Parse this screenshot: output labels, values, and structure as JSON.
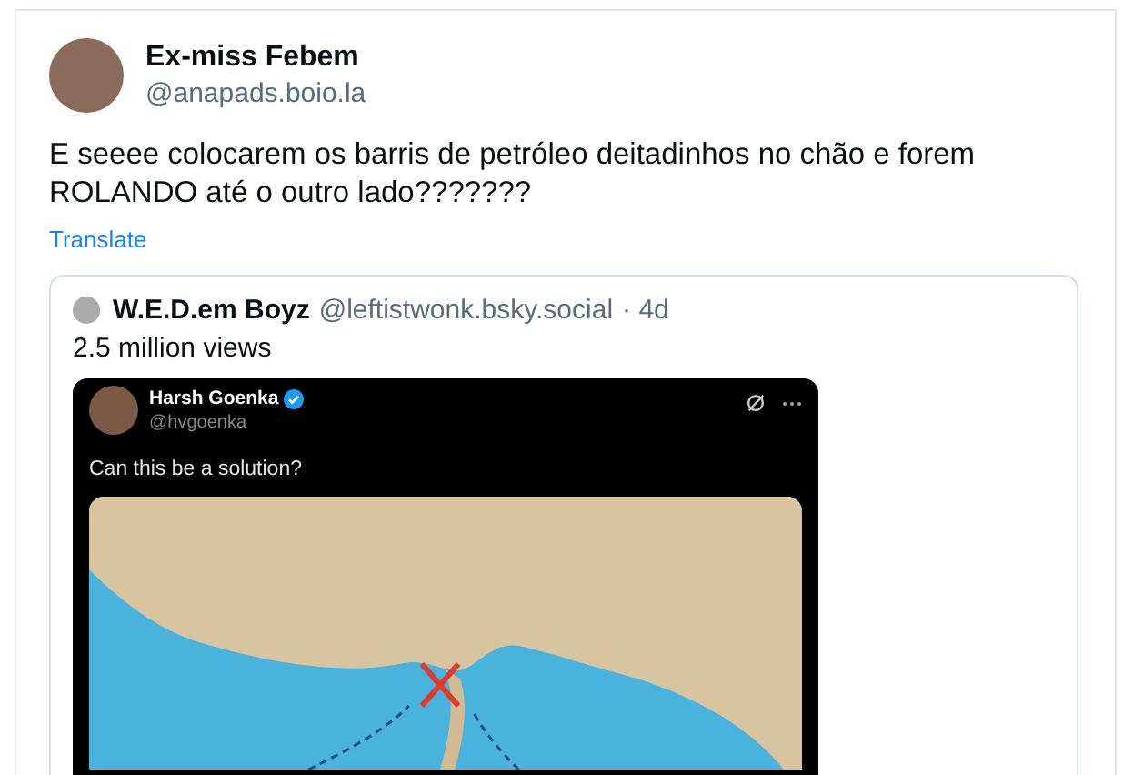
{
  "post": {
    "author": {
      "name": "Ex-miss Febem",
      "handle": "@anapads.boio.la"
    },
    "text": "E seeee colocarem os barris de petróleo deitadinhos no chão e forem ROLANDO até o outro lado???????",
    "translate_link": "Translate",
    "quote": {
      "author": {
        "name": "W.E.D.em Boyz",
        "handle": "@leftistwonk.bsky.social",
        "time": "· 4d"
      },
      "text": "2.5 million views",
      "embedded_screenshot": {
        "author": {
          "name": "Harsh Goenka",
          "handle": "@hvgoenka",
          "verified": true
        },
        "text": "Can this be a solution?"
      }
    }
  }
}
